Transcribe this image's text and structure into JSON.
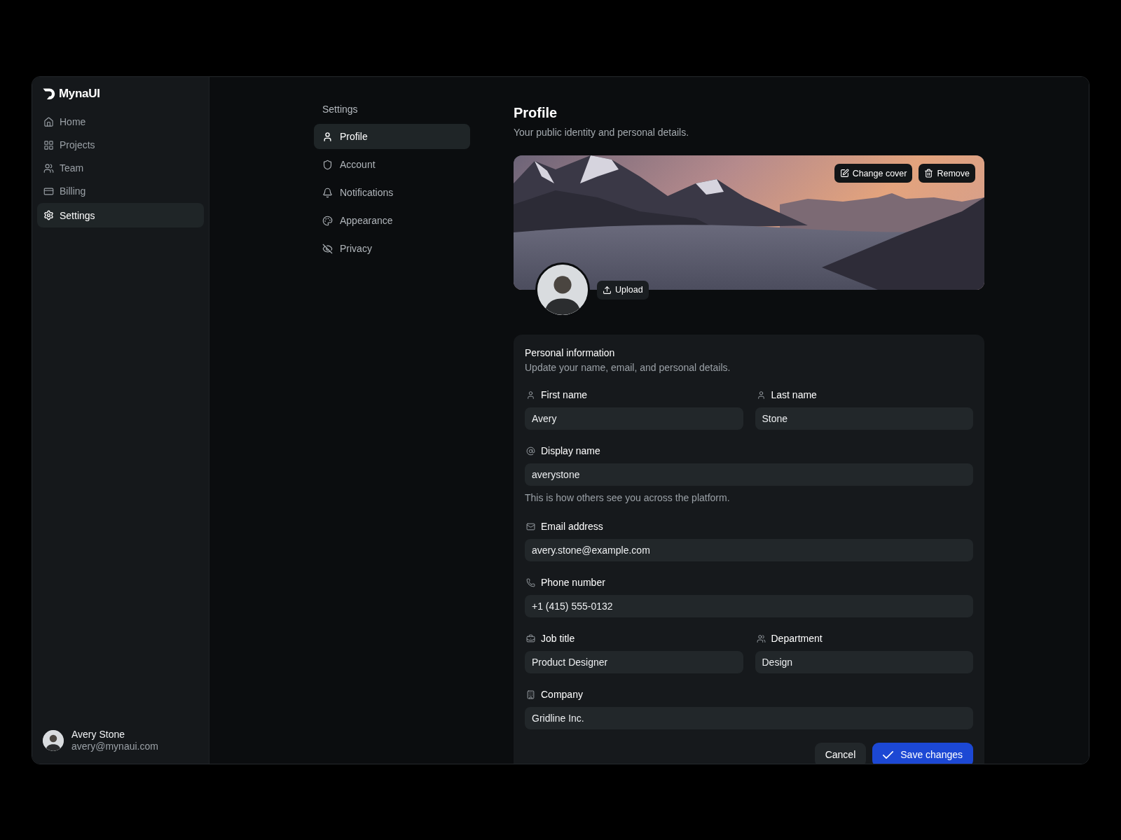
{
  "sidebar": {
    "brand": "MynaUI",
    "items": [
      {
        "label": "Home",
        "selected": false
      },
      {
        "label": "Projects",
        "selected": false
      },
      {
        "label": "Team",
        "selected": false
      },
      {
        "label": "Billing",
        "selected": false
      },
      {
        "label": "Settings",
        "selected": true
      }
    ],
    "user": {
      "name": "Avery Stone",
      "email": "avery@mynaui.com"
    }
  },
  "settings_nav": {
    "title": "Settings",
    "items": [
      {
        "label": "Profile",
        "selected": true
      },
      {
        "label": "Account",
        "selected": false
      },
      {
        "label": "Notifications",
        "selected": false
      },
      {
        "label": "Appearance",
        "selected": false
      },
      {
        "label": "Privacy",
        "selected": false
      }
    ]
  },
  "page": {
    "title": "Profile",
    "subtitle": "Your public identity and personal details."
  },
  "cover": {
    "buttons": [
      {
        "label": "Change cover"
      },
      {
        "label": "Remove"
      }
    ],
    "upload_button": "Upload"
  },
  "personal_information": {
    "title": "Personal information",
    "subtitle": "Update your name, email, and personal details.",
    "rows": [
      {
        "fields": [
          {
            "label": "First name",
            "value": "Avery"
          },
          {
            "label": "Last name",
            "value": "Stone"
          }
        ]
      },
      {
        "fields": [
          {
            "label": "Display name",
            "value": "averystone",
            "help_text": "This is how others see you across the platform."
          }
        ]
      },
      {
        "fields": [
          {
            "label": "Email address",
            "value": "avery.stone@example.com"
          }
        ]
      },
      {
        "fields": [
          {
            "label": "Phone number",
            "value": "+1 (415) 555-0132"
          }
        ]
      },
      {
        "fields": [
          {
            "label": "Job title",
            "value": "Product Designer"
          },
          {
            "label": "Department",
            "value": "Design"
          }
        ]
      },
      {
        "fields": [
          {
            "label": "Company",
            "value": "Gridline Inc."
          }
        ]
      }
    ],
    "actions": [
      {
        "label": "Cancel",
        "kind": "secondary"
      },
      {
        "label": "Save changes",
        "kind": "primary"
      }
    ]
  }
}
